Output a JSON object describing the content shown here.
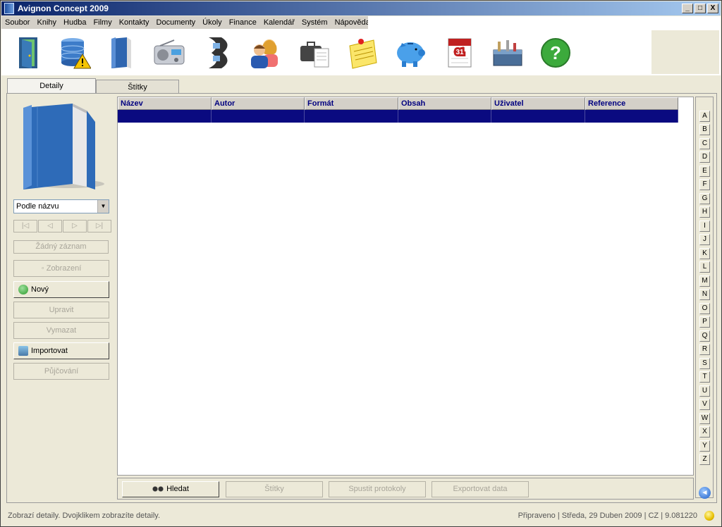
{
  "window": {
    "title": "Avignon Concept 2009",
    "controls": [
      "_",
      "□",
      "X"
    ]
  },
  "menu": [
    "Soubor",
    "Knihy",
    "Hudba",
    "Filmy",
    "Kontakty",
    "Documenty",
    "Úkoly",
    "Finance",
    "Kalendář",
    "Systém",
    "Nápověda"
  ],
  "toolbar": {
    "icons": [
      "door-icon",
      "database-warning-icon",
      "books-icon",
      "radio-icon",
      "film-icon",
      "contacts-icon",
      "briefcase-document-icon",
      "notes-icon",
      "piggy-bank-icon",
      "calendar-icon",
      "toolbox-icon",
      "help-icon"
    ],
    "calendar_day": "31",
    "help_glyph": "?"
  },
  "tabs": [
    "Detaily",
    "Štítky"
  ],
  "left_panel": {
    "sort": "Podle názvu",
    "nav": [
      "|◁",
      "◁",
      "▷",
      "▷|"
    ],
    "record_status": "Žádný záznam",
    "view_button": "Zobrazení",
    "view_prefix": "◦",
    "new_button": "Nový",
    "edit_button": "Upravit",
    "delete_button": "Vymazat",
    "import_button": "Importovat",
    "lend_button": "Půjčování"
  },
  "table": {
    "columns": [
      "Název",
      "Autor",
      "Formát",
      "Obsah",
      "Uživatel",
      "Reference"
    ]
  },
  "alphabet": [
    "A",
    "B",
    "C",
    "D",
    "E",
    "F",
    "G",
    "H",
    "I",
    "J",
    "K",
    "L",
    "M",
    "N",
    "O",
    "P",
    "Q",
    "R",
    "S",
    "T",
    "U",
    "V",
    "W",
    "X",
    "Y",
    "Z"
  ],
  "back_glyph": "◂",
  "bottom_bar": {
    "search": "Hledat",
    "tags": "Štítky",
    "run_logs": "Spustit protokoly",
    "export": "Exportovat data"
  },
  "statusbar": {
    "left": "Zobrazí detaily. Dvojklikem zobrazíte detaily.",
    "right": "Připraveno | Středa, 29 Duben 2009  | CZ | 9.081220"
  },
  "colors": {
    "title_gradient_start": "#0a246a",
    "selection": "#0a0a80",
    "header_text": "#000080"
  }
}
